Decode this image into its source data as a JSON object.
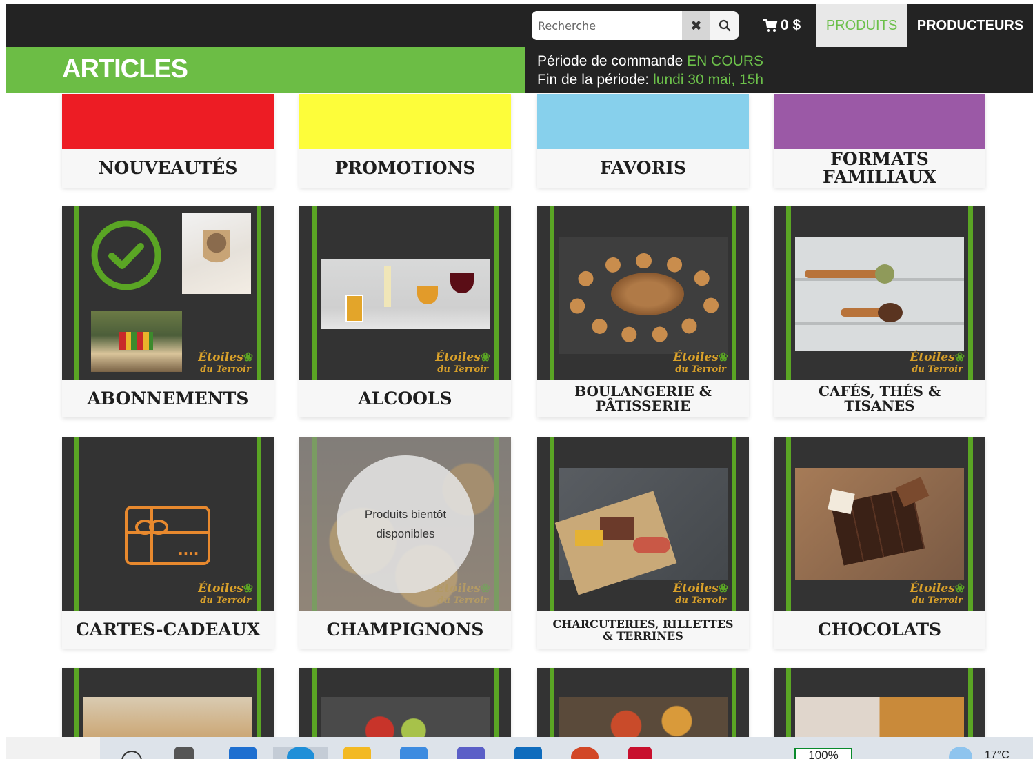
{
  "nav": {
    "search_placeholder": "Recherche",
    "clear_glyph": "✖",
    "cart_amount": "0 $",
    "tab_products": "PRODUITS",
    "tab_producers": "PRODUCTEURS"
  },
  "header": {
    "title": "ARTICLES",
    "period_label": "Période de commande ",
    "period_status": "EN COURS",
    "end_label": "Fin de la période: ",
    "end_value": "lundi 30 mai, 15h"
  },
  "colors": {
    "accent_green": "#6cbd45",
    "dark": "#232323",
    "new_red": "#ed1c24",
    "promo_yellow": "#fdfd3a",
    "fav_blue": "#87d0ec",
    "family_purple": "#9b59a6"
  },
  "categories": [
    {
      "label": "NOUVEAUTÉS",
      "kind": "color",
      "color": "#ed1c24"
    },
    {
      "label": "PROMOTIONS",
      "kind": "color",
      "color": "#fdfd3a"
    },
    {
      "label": "FAVORIS",
      "kind": "color",
      "color": "#87d0ec"
    },
    {
      "label": "FORMATS FAMILIAUX",
      "kind": "color",
      "color": "#9b59a6"
    },
    {
      "label": "ABONNEMENTS",
      "kind": "image",
      "icon": "subscription-collage"
    },
    {
      "label": "ALCOOLS",
      "kind": "image",
      "icon": "glasses-photo"
    },
    {
      "label": "BOULANGERIE & PÂTISSERIE",
      "kind": "image",
      "icon": "bread-photo"
    },
    {
      "label": "CAFÉS, THÉS & TISANES",
      "kind": "image",
      "icon": "coffee-photo"
    },
    {
      "label": "CARTES-CADEAUX",
      "kind": "image",
      "icon": "gift-card-icon"
    },
    {
      "label": "CHAMPIGNONS",
      "kind": "image",
      "icon": "mushrooms-photo",
      "overlay": "Produits bientôt disponibles"
    },
    {
      "label": "CHARCUTERIES, RILLETTES & TERRINES",
      "kind": "image",
      "icon": "charcuterie-photo"
    },
    {
      "label": "CHOCOLATS",
      "kind": "image",
      "icon": "chocolate-photo"
    }
  ],
  "logo": {
    "line1": "Étoiles",
    "line2": "du Terroir"
  },
  "taskbar": {
    "battery": "100%",
    "temperature": "17°C"
  }
}
